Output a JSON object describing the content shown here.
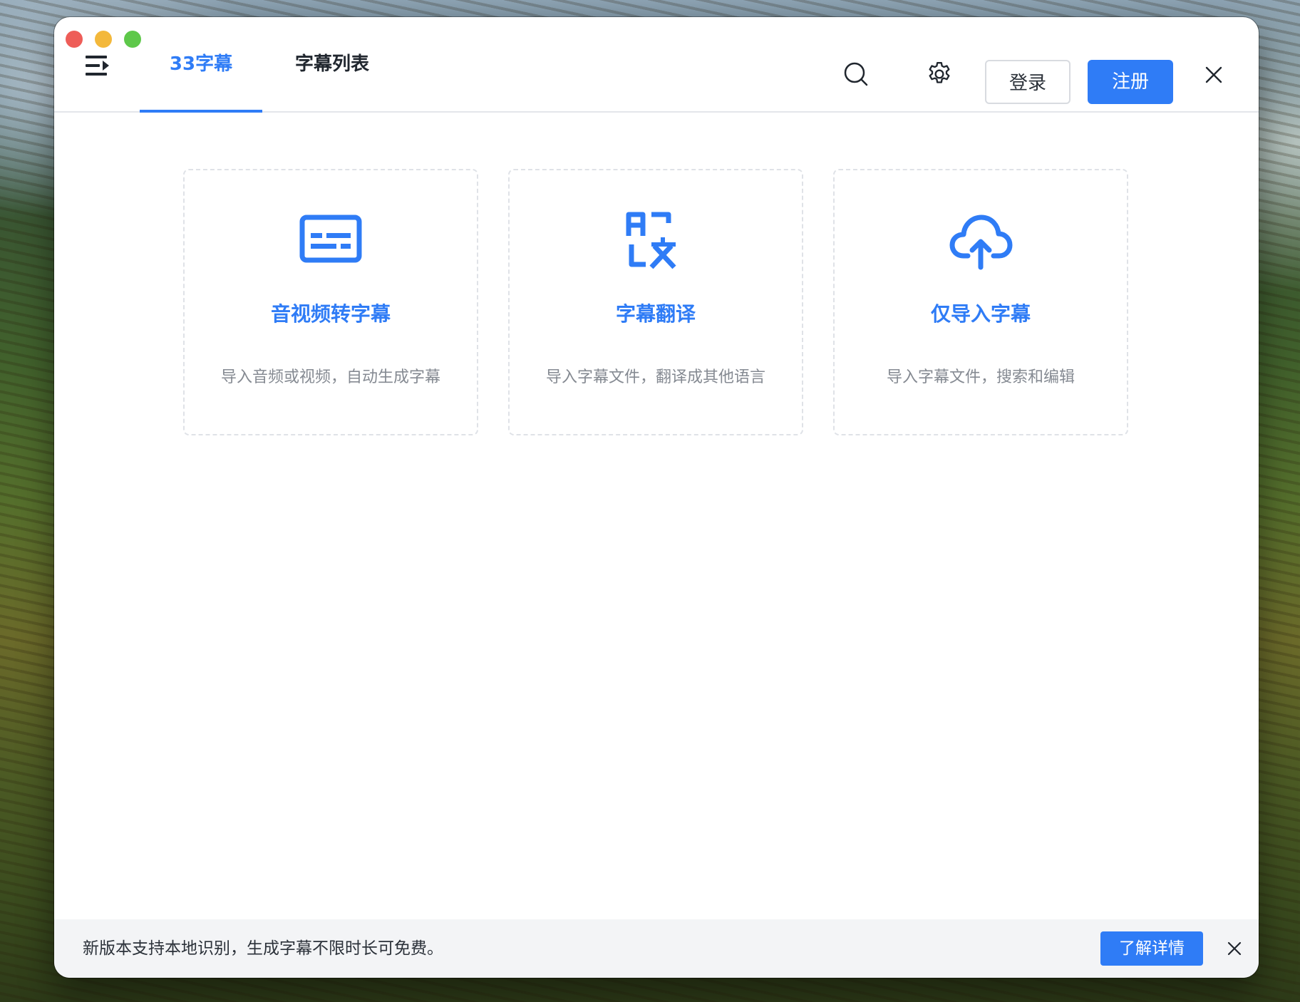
{
  "colors": {
    "accent": "#2f7cf6",
    "text_dark": "#20262e",
    "text_muted": "#858a92",
    "notice_bg": "#f3f4f6"
  },
  "header": {
    "menu_icon": "menu-collapse-icon",
    "tabs": [
      {
        "label": "33字幕",
        "active": true
      },
      {
        "label": "字幕列表",
        "active": false
      }
    ],
    "search_icon": "search-icon",
    "settings_icon": "gear-icon",
    "login_label": "登录",
    "signup_label": "注册",
    "close_icon": "close-icon"
  },
  "cards": [
    {
      "icon": "subtitle-icon",
      "title": "音视频转字幕",
      "desc": "导入音频或视频，自动生成字幕"
    },
    {
      "icon": "translate-icon",
      "title": "字幕翻译",
      "desc": "导入字幕文件，翻译成其他语言"
    },
    {
      "icon": "cloud-upload-icon",
      "title": "仅导入字幕",
      "desc": "导入字幕文件，搜索和编辑"
    }
  ],
  "notice": {
    "text": "新版本支持本地识别，生成字幕不限时长可免费。",
    "button_label": "了解详情",
    "close_icon": "close-icon"
  }
}
